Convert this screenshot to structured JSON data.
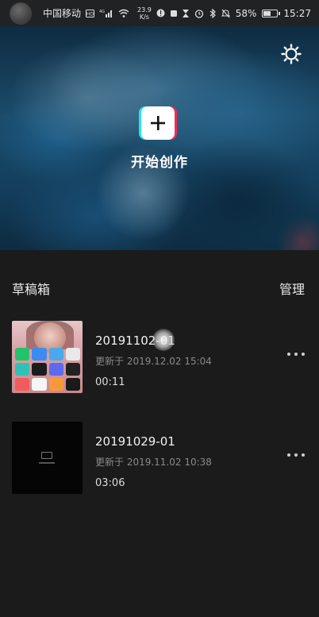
{
  "status_bar": {
    "carrier": "中国移动",
    "network_speed": "23.9",
    "network_speed_unit": "K/s",
    "battery": "58%",
    "battery_level": 0.58,
    "time": "15:27"
  },
  "hero": {
    "create_label": "开始创作",
    "settings_icon": "settings-sun-icon",
    "create_icon": "plus-icon"
  },
  "drafts": {
    "title": "草稿箱",
    "manage_label": "管理",
    "items": [
      {
        "name": "20191102-01",
        "updated": "更新于 2019.12.02 15:04",
        "duration": "00:11"
      },
      {
        "name": "20191029-01",
        "updated": "更新于 2019.11.02 10:38",
        "duration": "03:06"
      }
    ]
  },
  "colors": {
    "background": "#1b1b1b",
    "accent_cyan": "#27e4ee",
    "accent_red": "#f12a5a"
  }
}
